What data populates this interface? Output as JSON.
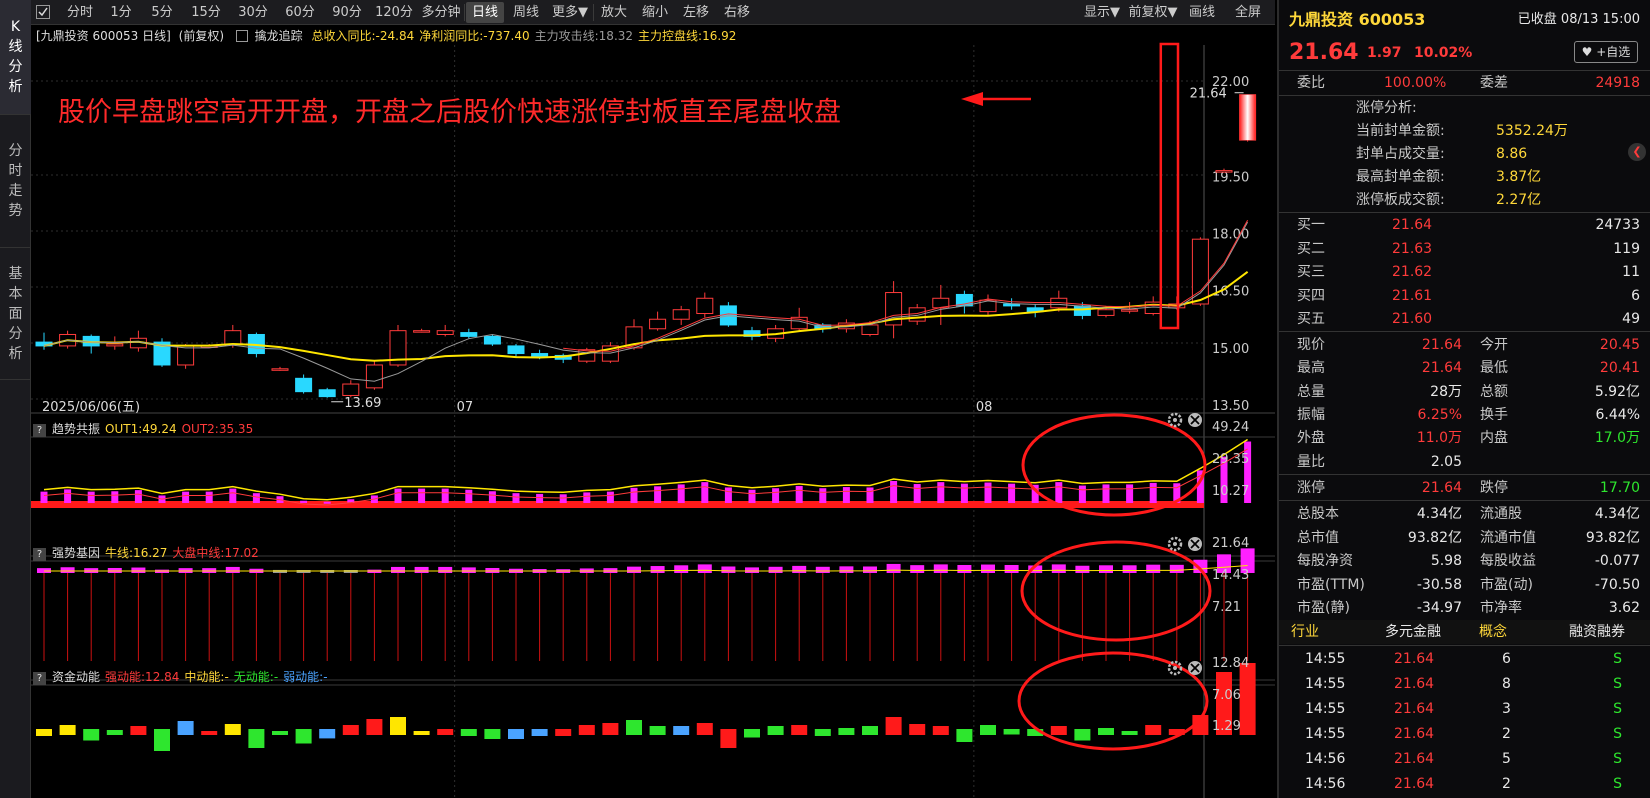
{
  "vtabs": [
    {
      "chars": [
        "K",
        "线",
        "分",
        "析"
      ],
      "active": true
    },
    {
      "chars": [
        "分",
        "时",
        "走",
        "势"
      ],
      "active": false
    },
    {
      "chars": [
        "基",
        "本",
        "面",
        "分",
        "析"
      ],
      "active": false
    }
  ],
  "toolbar": {
    "left": [
      "分时",
      "1分",
      "5分",
      "15分",
      "30分",
      "60分",
      "90分",
      "120分",
      "多分钟",
      "日线",
      "周线",
      "更多▼",
      "放大",
      "缩小",
      "左移",
      "右移"
    ],
    "active": "日线",
    "right": [
      "显示▼",
      "前复权▼",
      "画线",
      "全屏"
    ]
  },
  "chart_header": {
    "name": "[九鼎投资 600053 日线]",
    "adjust": "(前复权)",
    "indicator": "擒龙追踪",
    "items": [
      {
        "text": "总收入同比:-24.84",
        "color": "#ffd83a"
      },
      {
        "text": "净利润同比:-737.40",
        "color": "#ffd83a"
      },
      {
        "text": "主力攻击线:18.32",
        "color": "#9a9a9a"
      },
      {
        "text": "主力控盘线:16.92",
        "color": "#ffd83a"
      }
    ]
  },
  "annotation": {
    "text": "股价早盘跳空高开开盘，开盘之后股价快速涨停封板直至尾盘收盘",
    "color": "#ff2a2a"
  },
  "price_axis": [
    "22.00",
    "19.50",
    "18.00",
    "16.50",
    "15.00",
    "13.50"
  ],
  "date_labels": [
    "2025/06/06(五)",
    "07",
    "08"
  ],
  "low_label": "13.69",
  "high_label": "21.64",
  "panels": [
    {
      "title": "趋势共振",
      "items": [
        {
          "text": "OUT1:49.24",
          "color": "#ffd83a"
        },
        {
          "text": "OUT2:35.35",
          "color": "#ff3b3b"
        }
      ],
      "axis": [
        "49.24",
        "29.35",
        "10.27"
      ]
    },
    {
      "title": "强势基因",
      "items": [
        {
          "text": "牛线:16.27",
          "color": "#ffd83a"
        },
        {
          "text": "大盘中线:17.02",
          "color": "#ff3b3b"
        }
      ],
      "axis": [
        "21.64",
        "14.43",
        "7.21"
      ]
    },
    {
      "title": "资金动能",
      "items": [
        {
          "text": "强动能:12.84",
          "color": "#ff3b3b"
        },
        {
          "text": "中动能:-",
          "color": "#ffd83a"
        },
        {
          "text": "无动能:-",
          "color": "#2ee62e"
        },
        {
          "text": "弱动能:-",
          "color": "#4aa3ff"
        }
      ],
      "axis": [
        "12.84",
        "7.06",
        "1.29"
      ]
    }
  ],
  "candles": [
    {
      "o": 15.15,
      "c": 15.05,
      "h": 15.4,
      "l": 14.95
    },
    {
      "o": 15.05,
      "c": 15.35,
      "h": 15.45,
      "l": 14.98
    },
    {
      "o": 15.3,
      "c": 15.05,
      "h": 15.35,
      "l": 14.85
    },
    {
      "o": 15.05,
      "c": 15.1,
      "h": 15.3,
      "l": 14.95
    },
    {
      "o": 15.0,
      "c": 15.25,
      "h": 15.45,
      "l": 14.9
    },
    {
      "o": 15.15,
      "c": 14.55,
      "h": 15.25,
      "l": 14.5
    },
    {
      "o": 14.55,
      "c": 15.05,
      "h": 15.1,
      "l": 14.45
    },
    {
      "o": 15.05,
      "c": 15.05,
      "h": 15.1,
      "l": 15.0
    },
    {
      "o": 15.1,
      "c": 15.45,
      "h": 15.6,
      "l": 15.0
    },
    {
      "o": 15.35,
      "c": 14.85,
      "h": 15.4,
      "l": 14.75
    },
    {
      "o": 14.45,
      "c": 14.45,
      "h": 14.5,
      "l": 14.4
    },
    {
      "o": 14.2,
      "c": 13.85,
      "h": 14.3,
      "l": 13.8
    },
    {
      "o": 13.9,
      "c": 13.72,
      "h": 13.95,
      "l": 13.69
    },
    {
      "o": 13.75,
      "c": 14.05,
      "h": 14.15,
      "l": 13.7
    },
    {
      "o": 13.95,
      "c": 14.55,
      "h": 14.65,
      "l": 13.9
    },
    {
      "o": 14.55,
      "c": 15.45,
      "h": 15.6,
      "l": 14.5
    },
    {
      "o": 15.45,
      "c": 15.45,
      "h": 15.5,
      "l": 15.4
    },
    {
      "o": 15.35,
      "c": 15.45,
      "h": 15.6,
      "l": 15.3
    },
    {
      "o": 15.4,
      "c": 15.3,
      "h": 15.5,
      "l": 15.25
    },
    {
      "o": 15.3,
      "c": 15.1,
      "h": 15.35,
      "l": 15.05
    },
    {
      "o": 15.05,
      "c": 14.85,
      "h": 15.1,
      "l": 14.75
    },
    {
      "o": 14.85,
      "c": 14.75,
      "h": 14.95,
      "l": 14.7
    },
    {
      "o": 14.8,
      "c": 14.7,
      "h": 14.85,
      "l": 14.6
    },
    {
      "o": 14.65,
      "c": 14.95,
      "h": 15.0,
      "l": 14.6
    },
    {
      "o": 14.65,
      "c": 15.05,
      "h": 15.15,
      "l": 14.6
    },
    {
      "o": 15.0,
      "c": 15.55,
      "h": 15.75,
      "l": 14.95
    },
    {
      "o": 15.5,
      "c": 15.75,
      "h": 15.95,
      "l": 15.45
    },
    {
      "o": 15.75,
      "c": 16.0,
      "h": 16.1,
      "l": 15.6
    },
    {
      "o": 15.9,
      "c": 16.3,
      "h": 16.45,
      "l": 15.8
    },
    {
      "o": 16.1,
      "c": 15.6,
      "h": 16.2,
      "l": 15.55
    },
    {
      "o": 15.45,
      "c": 15.3,
      "h": 15.55,
      "l": 15.2
    },
    {
      "o": 15.25,
      "c": 15.5,
      "h": 15.6,
      "l": 15.15
    },
    {
      "o": 15.5,
      "c": 15.8,
      "h": 16.05,
      "l": 15.45
    },
    {
      "o": 15.6,
      "c": 15.5,
      "h": 15.65,
      "l": 15.4
    },
    {
      "o": 15.5,
      "c": 15.65,
      "h": 15.75,
      "l": 15.4
    },
    {
      "o": 15.35,
      "c": 15.6,
      "h": 15.7,
      "l": 15.3
    },
    {
      "o": 15.6,
      "c": 16.45,
      "h": 16.75,
      "l": 15.25
    },
    {
      "o": 15.7,
      "c": 16.05,
      "h": 16.15,
      "l": 15.6
    },
    {
      "o": 16.05,
      "c": 16.3,
      "h": 16.65,
      "l": 15.6
    },
    {
      "o": 16.4,
      "c": 16.1,
      "h": 16.5,
      "l": 15.9
    },
    {
      "o": 15.95,
      "c": 16.25,
      "h": 16.4,
      "l": 15.85
    },
    {
      "o": 16.15,
      "c": 16.1,
      "h": 16.3,
      "l": 16.0
    },
    {
      "o": 16.05,
      "c": 15.95,
      "h": 16.15,
      "l": 15.8
    },
    {
      "o": 16.05,
      "c": 16.3,
      "h": 16.5,
      "l": 15.95
    },
    {
      "o": 16.1,
      "c": 15.85,
      "h": 16.2,
      "l": 15.75
    },
    {
      "o": 15.85,
      "c": 16.0,
      "h": 16.1,
      "l": 15.8
    },
    {
      "o": 16.0,
      "c": 16.0,
      "h": 16.2,
      "l": 15.9
    },
    {
      "o": 15.9,
      "c": 16.2,
      "h": 16.35,
      "l": 15.85
    },
    {
      "o": 16.05,
      "c": 16.15,
      "h": 16.35,
      "l": 16.0
    },
    {
      "o": 16.15,
      "c": 17.85,
      "h": 17.9,
      "l": 16.1
    },
    {
      "o": 19.65,
      "c": 19.65,
      "h": 19.7,
      "l": 19.6
    },
    {
      "o": 20.45,
      "c": 21.64,
      "h": 21.64,
      "l": 20.41
    }
  ],
  "ma_lines": [
    {
      "name": "主力控盘线",
      "color": "#ffe600"
    },
    {
      "name": "主力攻击线",
      "color": "#9a9a9a"
    }
  ],
  "quote": {
    "name": "九鼎投资 600053",
    "status": "已收盘 08/13 15:00",
    "price": "21.64",
    "change": "1.97",
    "pct": "10.02%",
    "watch_btn": "♥ +自选",
    "weibi_label": "委比",
    "weibi": "100.00%",
    "weicha_label": "委差",
    "weicha": "24918",
    "limit_title": "涨停分析:",
    "limit_rows": [
      {
        "label": "当前封单金额:",
        "value": "5352.24万"
      },
      {
        "label": "封单占成交量:",
        "value": "8.86"
      },
      {
        "label": "最高封单金额:",
        "value": "3.87亿"
      },
      {
        "label": "涨停板成交额:",
        "value": "2.27亿"
      }
    ],
    "bids": [
      {
        "label": "买一",
        "price": "21.64",
        "vol": "24733"
      },
      {
        "label": "买二",
        "price": "21.63",
        "vol": "119"
      },
      {
        "label": "买三",
        "price": "21.62",
        "vol": "11"
      },
      {
        "label": "买四",
        "price": "21.61",
        "vol": "6"
      },
      {
        "label": "买五",
        "price": "21.60",
        "vol": "49"
      }
    ],
    "stats": [
      [
        {
          "l": "现价",
          "v": "21.64",
          "c": "red"
        },
        {
          "l": "今开",
          "v": "20.45",
          "c": "red"
        }
      ],
      [
        {
          "l": "最高",
          "v": "21.64",
          "c": "red"
        },
        {
          "l": "最低",
          "v": "20.41",
          "c": "red"
        }
      ],
      [
        {
          "l": "总量",
          "v": "28万",
          "c": "white"
        },
        {
          "l": "总额",
          "v": "5.92亿",
          "c": "white"
        }
      ],
      [
        {
          "l": "振幅",
          "v": "6.25%",
          "c": "red"
        },
        {
          "l": "换手",
          "v": "6.44%",
          "c": "white"
        }
      ],
      [
        {
          "l": "外盘",
          "v": "11.0万",
          "c": "red"
        },
        {
          "l": "内盘",
          "v": "17.0万",
          "c": "green"
        }
      ],
      [
        {
          "l": "量比",
          "v": "2.05",
          "c": "white"
        },
        {
          "l": "",
          "v": "",
          "c": "white"
        }
      ]
    ],
    "limits": [
      {
        "l": "涨停",
        "v": "21.64",
        "c": "red"
      },
      {
        "l": "跌停",
        "v": "17.70",
        "c": "green"
      }
    ],
    "fundamentals": [
      [
        {
          "l": "总股本",
          "v": "4.34亿"
        },
        {
          "l": "流通股",
          "v": "4.34亿"
        }
      ],
      [
        {
          "l": "总市值",
          "v": "93.82亿"
        },
        {
          "l": "流通市值",
          "v": "93.82亿"
        }
      ],
      [
        {
          "l": "每股净资",
          "v": "5.98"
        },
        {
          "l": "每股收益",
          "v": "-0.077"
        }
      ],
      [
        {
          "l": "市盈(TTM)",
          "v": "-30.58"
        },
        {
          "l": "市盈(动)",
          "v": "-70.50"
        }
      ],
      [
        {
          "l": "市盈(静)",
          "v": "-34.97"
        },
        {
          "l": "市净率",
          "v": "3.62"
        }
      ]
    ],
    "tags": [
      "行业",
      "多元金融",
      "概念",
      "融资融券"
    ],
    "ticks": [
      {
        "t": "14:55",
        "p": "21.64",
        "v": "6",
        "s": "S"
      },
      {
        "t": "14:55",
        "p": "21.64",
        "v": "8",
        "s": "S"
      },
      {
        "t": "14:55",
        "p": "21.64",
        "v": "3",
        "s": "S"
      },
      {
        "t": "14:55",
        "p": "21.64",
        "v": "2",
        "s": "S"
      },
      {
        "t": "14:56",
        "p": "21.64",
        "v": "5",
        "s": "S"
      },
      {
        "t": "14:56",
        "p": "21.64",
        "v": "2",
        "s": "S"
      }
    ]
  }
}
